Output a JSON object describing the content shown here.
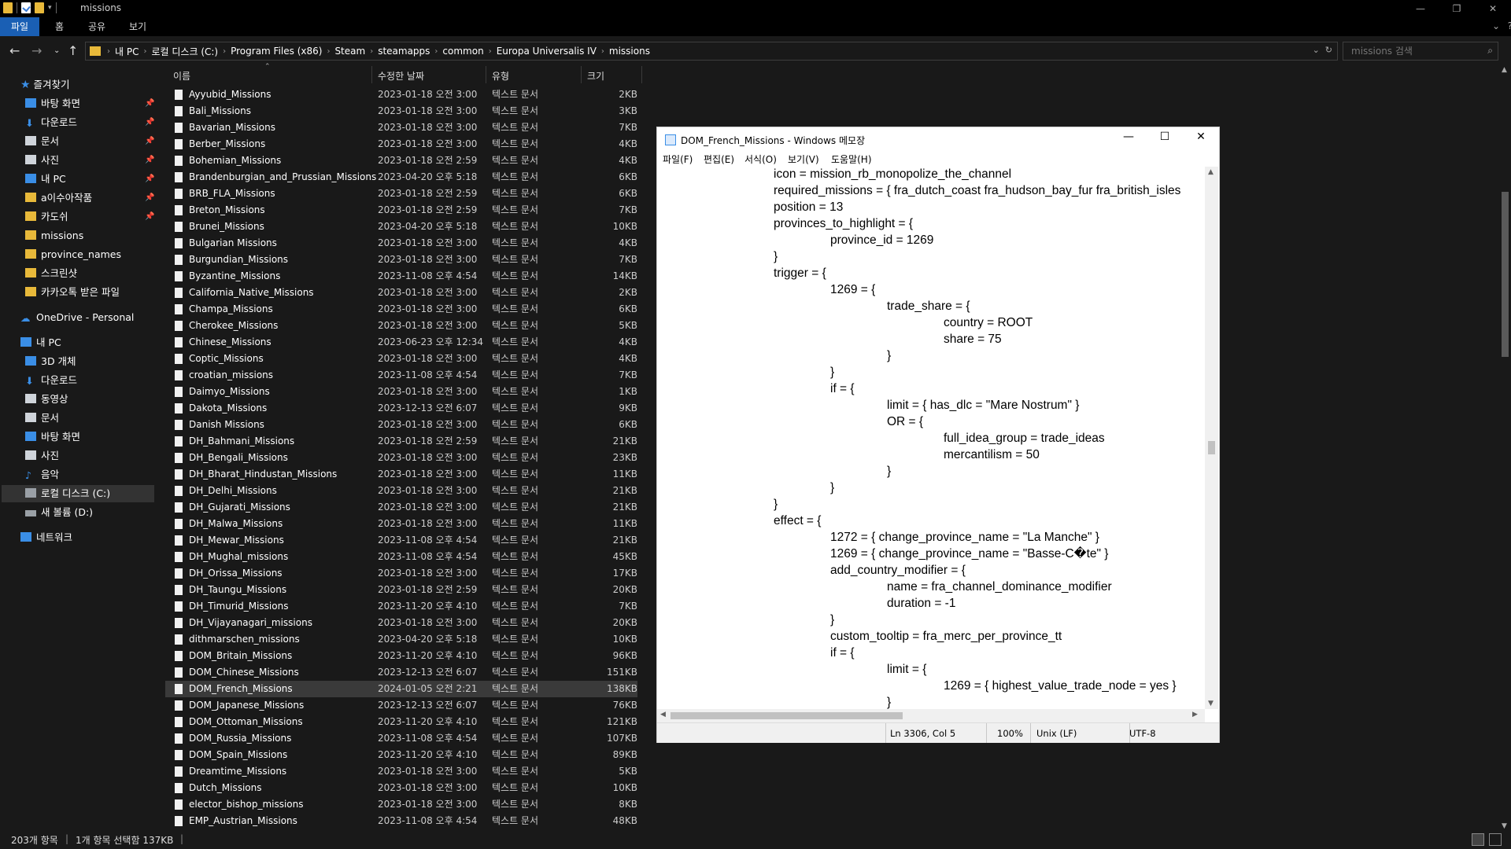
{
  "window": {
    "title": "missions"
  },
  "ribbon": {
    "tabs": [
      "파일",
      "홈",
      "공유",
      "보기"
    ]
  },
  "address": {
    "segments": [
      "내 PC",
      "로컬 디스크 (C:)",
      "Program Files (x86)",
      "Steam",
      "steamapps",
      "common",
      "Europa Universalis IV",
      "missions"
    ]
  },
  "search": {
    "placeholder": "missions 검색"
  },
  "sidebar": {
    "quick_access": "즐겨찾기",
    "quick_items": [
      "바탕 화면",
      "다운로드",
      "문서",
      "사진",
      "내 PC",
      "a이수아작품",
      "카도쉬",
      "missions",
      "province_names",
      "스크린샷",
      "카카오톡 받은 파일"
    ],
    "onedrive": "OneDrive - Personal",
    "this_pc": "내 PC",
    "pc_items": [
      "3D 개체",
      "다운로드",
      "동영상",
      "문서",
      "바탕 화면",
      "사진",
      "음악",
      "로컬 디스크 (C:)",
      "새 볼륨 (D:)"
    ],
    "network": "네트워크"
  },
  "columns": {
    "name": "이름",
    "date": "수정한 날짜",
    "type": "유형",
    "size": "크기"
  },
  "files": [
    [
      "Ayyubid_Missions",
      "2023-01-18 오전 3:00",
      "텍스트 문서",
      "2KB"
    ],
    [
      "Bali_Missions",
      "2023-01-18 오전 3:00",
      "텍스트 문서",
      "3KB"
    ],
    [
      "Bavarian_Missions",
      "2023-01-18 오전 3:00",
      "텍스트 문서",
      "7KB"
    ],
    [
      "Berber_Missions",
      "2023-01-18 오전 3:00",
      "텍스트 문서",
      "4KB"
    ],
    [
      "Bohemian_Missions",
      "2023-01-18 오전 2:59",
      "텍스트 문서",
      "4KB"
    ],
    [
      "Brandenburgian_and_Prussian_Missions",
      "2023-04-20 오후 5:18",
      "텍스트 문서",
      "6KB"
    ],
    [
      "BRB_FLA_Missions",
      "2023-01-18 오전 2:59",
      "텍스트 문서",
      "6KB"
    ],
    [
      "Breton_Missions",
      "2023-01-18 오전 2:59",
      "텍스트 문서",
      "7KB"
    ],
    [
      "Brunei_Missions",
      "2023-04-20 오후 5:18",
      "텍스트 문서",
      "10KB"
    ],
    [
      "Bulgarian Missions",
      "2023-01-18 오전 3:00",
      "텍스트 문서",
      "4KB"
    ],
    [
      "Burgundian_Missions",
      "2023-01-18 오전 3:00",
      "텍스트 문서",
      "7KB"
    ],
    [
      "Byzantine_Missions",
      "2023-11-08 오후 4:54",
      "텍스트 문서",
      "14KB"
    ],
    [
      "California_Native_Missions",
      "2023-01-18 오전 3:00",
      "텍스트 문서",
      "2KB"
    ],
    [
      "Champa_Missions",
      "2023-01-18 오전 3:00",
      "텍스트 문서",
      "6KB"
    ],
    [
      "Cherokee_Missions",
      "2023-01-18 오전 3:00",
      "텍스트 문서",
      "5KB"
    ],
    [
      "Chinese_Missions",
      "2023-06-23 오후 12:34",
      "텍스트 문서",
      "4KB"
    ],
    [
      "Coptic_Missions",
      "2023-01-18 오전 3:00",
      "텍스트 문서",
      "4KB"
    ],
    [
      "croatian_missions",
      "2023-11-08 오후 4:54",
      "텍스트 문서",
      "7KB"
    ],
    [
      "Daimyo_Missions",
      "2023-01-18 오전 3:00",
      "텍스트 문서",
      "1KB"
    ],
    [
      "Dakota_Missions",
      "2023-12-13 오전 6:07",
      "텍스트 문서",
      "9KB"
    ],
    [
      "Danish Missions",
      "2023-01-18 오전 3:00",
      "텍스트 문서",
      "6KB"
    ],
    [
      "DH_Bahmani_Missions",
      "2023-01-18 오전 2:59",
      "텍스트 문서",
      "21KB"
    ],
    [
      "DH_Bengali_Missions",
      "2023-01-18 오전 3:00",
      "텍스트 문서",
      "23KB"
    ],
    [
      "DH_Bharat_Hindustan_Missions",
      "2023-01-18 오전 3:00",
      "텍스트 문서",
      "11KB"
    ],
    [
      "DH_Delhi_Missions",
      "2023-01-18 오전 3:00",
      "텍스트 문서",
      "21KB"
    ],
    [
      "DH_Gujarati_Missions",
      "2023-01-18 오전 3:00",
      "텍스트 문서",
      "21KB"
    ],
    [
      "DH_Malwa_Missions",
      "2023-01-18 오전 3:00",
      "텍스트 문서",
      "11KB"
    ],
    [
      "DH_Mewar_Missions",
      "2023-11-08 오후 4:54",
      "텍스트 문서",
      "21KB"
    ],
    [
      "DH_Mughal_missions",
      "2023-11-08 오후 4:54",
      "텍스트 문서",
      "45KB"
    ],
    [
      "DH_Orissa_Missions",
      "2023-01-18 오전 3:00",
      "텍스트 문서",
      "17KB"
    ],
    [
      "DH_Taungu_Missions",
      "2023-01-18 오전 2:59",
      "텍스트 문서",
      "20KB"
    ],
    [
      "DH_Timurid_Missions",
      "2023-11-20 오후 4:10",
      "텍스트 문서",
      "7KB"
    ],
    [
      "DH_Vijayanagari_missions",
      "2023-01-18 오전 3:00",
      "텍스트 문서",
      "20KB"
    ],
    [
      "dithmarschen_missions",
      "2023-04-20 오후 5:18",
      "텍스트 문서",
      "10KB"
    ],
    [
      "DOM_Britain_Missions",
      "2023-11-20 오후 4:10",
      "텍스트 문서",
      "96KB"
    ],
    [
      "DOM_Chinese_Missions",
      "2023-12-13 오전 6:07",
      "텍스트 문서",
      "151KB"
    ],
    [
      "DOM_French_Missions",
      "2024-01-05 오전 2:21",
      "텍스트 문서",
      "138KB"
    ],
    [
      "DOM_Japanese_Missions",
      "2023-12-13 오전 6:07",
      "텍스트 문서",
      "76KB"
    ],
    [
      "DOM_Ottoman_Missions",
      "2023-11-20 오후 4:10",
      "텍스트 문서",
      "121KB"
    ],
    [
      "DOM_Russia_Missions",
      "2023-11-08 오후 4:54",
      "텍스트 문서",
      "107KB"
    ],
    [
      "DOM_Spain_Missions",
      "2023-11-20 오후 4:10",
      "텍스트 문서",
      "89KB"
    ],
    [
      "Dreamtime_Missions",
      "2023-01-18 오전 3:00",
      "텍스트 문서",
      "5KB"
    ],
    [
      "Dutch_Missions",
      "2023-01-18 오전 3:00",
      "텍스트 문서",
      "10KB"
    ],
    [
      "elector_bishop_missions",
      "2023-01-18 오전 3:00",
      "텍스트 문서",
      "8KB"
    ],
    [
      "EMP_Austrian_Missions",
      "2023-11-08 오후 4:54",
      "텍스트 문서",
      "48KB"
    ]
  ],
  "selected_file": "DOM_French_Missions",
  "status": {
    "count": "203개 항목",
    "selection": "1개 항목 선택함 137KB"
  },
  "notepad": {
    "title": "DOM_French_Missions - Windows 메모장",
    "menu": [
      "파일(F)",
      "편집(E)",
      "서식(O)",
      "보기(V)",
      "도움말(H)"
    ],
    "lines": [
      [
        0,
        "icon = mission_rb_monopolize_the_channel"
      ],
      [
        0,
        "required_missions = { fra_dutch_coast fra_hudson_bay_fur fra_british_isles"
      ],
      [
        0,
        "position = 13"
      ],
      [
        0,
        "provinces_to_highlight = {"
      ],
      [
        1,
        "province_id = 1269"
      ],
      [
        0,
        "}"
      ],
      [
        0,
        "trigger = {"
      ],
      [
        1,
        "1269 = {"
      ],
      [
        2,
        "trade_share = {"
      ],
      [
        3,
        "country = ROOT"
      ],
      [
        3,
        "share = 75"
      ],
      [
        2,
        "}"
      ],
      [
        1,
        "}"
      ],
      [
        1,
        "if = {"
      ],
      [
        2,
        "limit = { has_dlc = \"Mare Nostrum\" }"
      ],
      [
        2,
        "OR = {"
      ],
      [
        3,
        "full_idea_group = trade_ideas"
      ],
      [
        3,
        "mercantilism = 50"
      ],
      [
        2,
        "}"
      ],
      [
        1,
        "}"
      ],
      [
        0,
        "}"
      ],
      [
        0,
        "effect = {"
      ],
      [
        1,
        "1272 = { change_province_name = \"La Manche\" }"
      ],
      [
        1,
        "1269 = { change_province_name = \"Basse-C�te\" }"
      ],
      [
        1,
        "add_country_modifier = {"
      ],
      [
        2,
        "name = fra_channel_dominance_modifier"
      ],
      [
        2,
        "duration = -1"
      ],
      [
        1,
        "}"
      ],
      [
        1,
        "custom_tooltip = fra_merc_per_province_tt"
      ],
      [
        1,
        "if = {"
      ],
      [
        2,
        "limit = {"
      ],
      [
        3,
        "1269 = { highest_value_trade_node = yes }"
      ],
      [
        2,
        "}"
      ]
    ],
    "status": {
      "position": "Ln 3306, Col 5",
      "zoom": "100%",
      "eol": "Unix (LF)",
      "encoding": "UTF-8"
    }
  }
}
